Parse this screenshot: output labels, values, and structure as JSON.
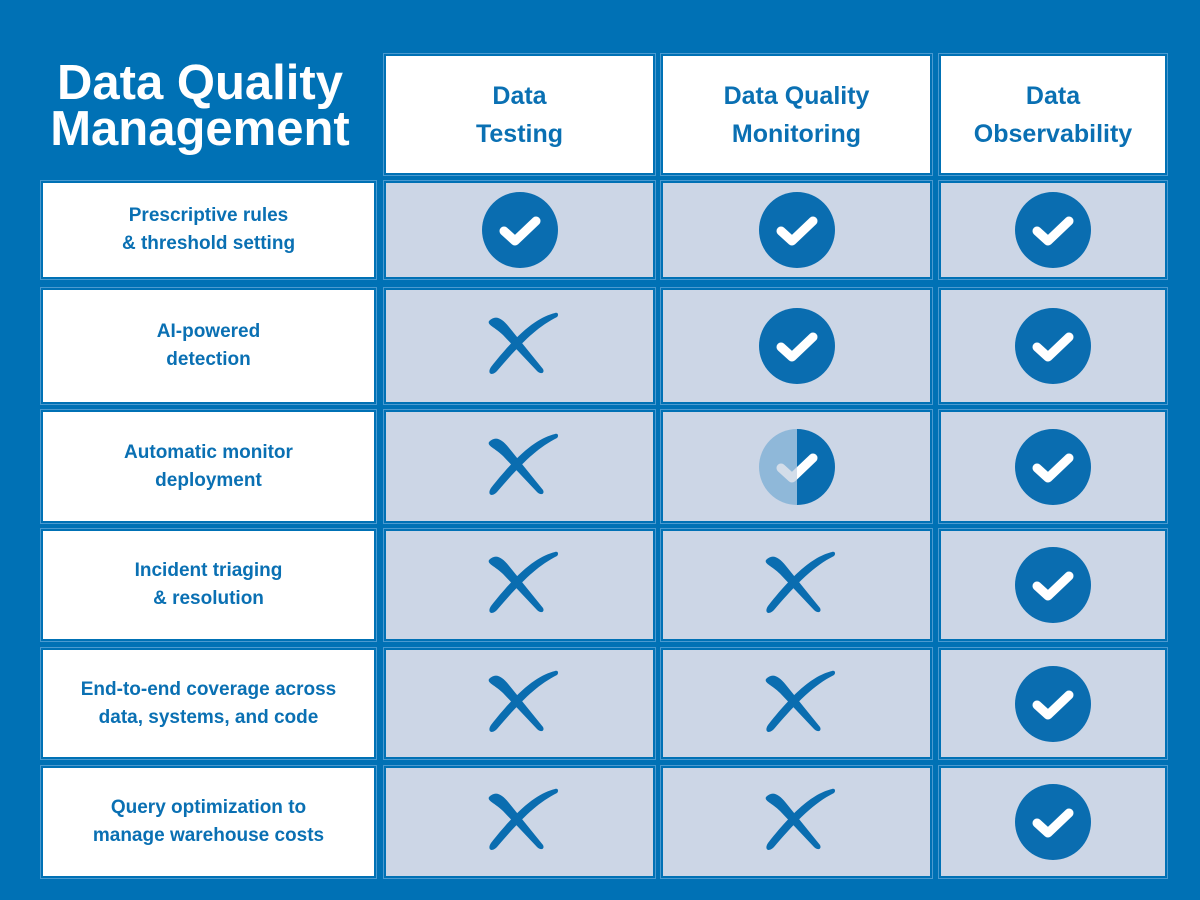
{
  "title": {
    "line1": "Data Quality",
    "line2": "Management"
  },
  "columns": [
    {
      "line1": "Data",
      "line2": "Testing"
    },
    {
      "line1": "Data Quality",
      "line2": "Monitoring"
    },
    {
      "line1": "Data",
      "line2": "Observability"
    }
  ],
  "rows": [
    {
      "line1": "Prescriptive rules",
      "line2": "& threshold setting",
      "values": [
        "check",
        "check",
        "check"
      ]
    },
    {
      "line1": "AI-powered",
      "line2": "detection",
      "values": [
        "cross",
        "check",
        "check"
      ]
    },
    {
      "line1": "Automatic monitor",
      "line2": "deployment",
      "values": [
        "cross",
        "partial-check",
        "check"
      ]
    },
    {
      "line1": "Incident triaging",
      "line2": "& resolution",
      "values": [
        "cross",
        "cross",
        "check"
      ]
    },
    {
      "line1": "End-to-end coverage across",
      "line2": "data, systems, and code",
      "values": [
        "cross",
        "cross",
        "check"
      ]
    },
    {
      "line1": "Query optimization to",
      "line2": "manage warehouse costs",
      "values": [
        "cross",
        "cross",
        "check"
      ]
    }
  ],
  "colors": {
    "background": "#0071b5",
    "accent": "#0a70b3",
    "cell_grey": "#ccd6e6",
    "partial_light": "#8fb8d9"
  }
}
